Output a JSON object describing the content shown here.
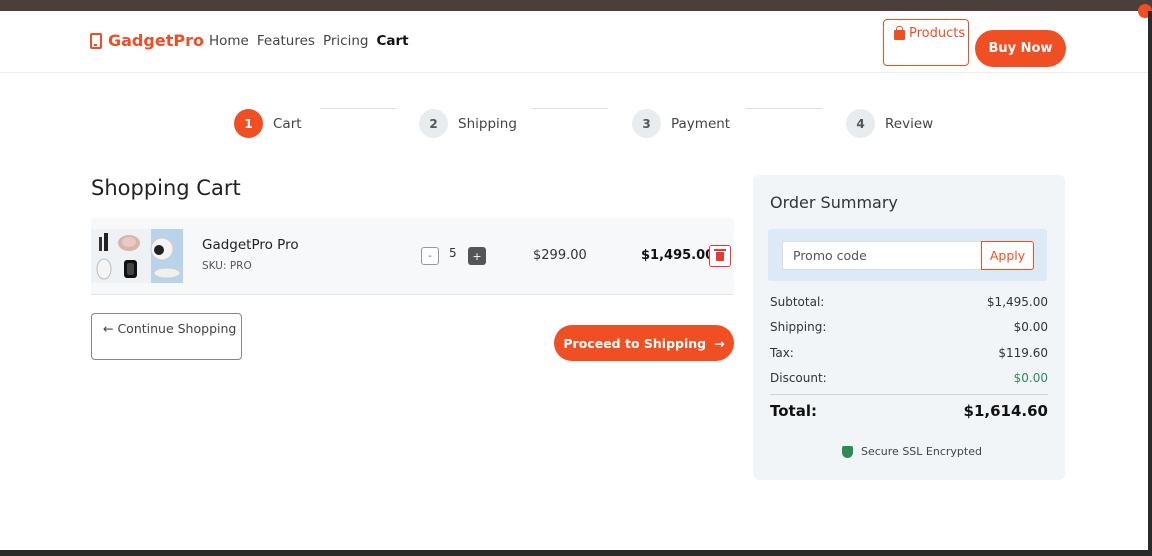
{
  "brand": {
    "name": "GadgetPro"
  },
  "nav": {
    "links": [
      "Home",
      "Features",
      "Pricing",
      "Cart"
    ]
  },
  "header": {
    "products_label": "Products",
    "buy_label": "Buy Now"
  },
  "steps": [
    {
      "num": "1",
      "label": "Cart"
    },
    {
      "num": "2",
      "label": "Shipping"
    },
    {
      "num": "3",
      "label": "Payment"
    },
    {
      "num": "4",
      "label": "Review"
    }
  ],
  "cart": {
    "title": "Shopping Cart",
    "item": {
      "name": "GadgetPro Pro",
      "sku": "SKU: PRO",
      "qty_minus": "-",
      "qty": "5",
      "qty_plus": "+",
      "unit_price": "$299.00",
      "line_total": "$1,495.00"
    },
    "continue_label": "← Continue Shopping",
    "proceed_label": "Proceed to Shipping",
    "proceed_arrow": "→"
  },
  "summary": {
    "title": "Order Summary",
    "promo_placeholder": "Promo code",
    "apply_label": "Apply",
    "subtotal_label": "Subtotal:",
    "subtotal": "$1,495.00",
    "shipping_label": "Shipping:",
    "shipping": "$0.00",
    "tax_label": "Tax:",
    "tax": "$119.60",
    "discount_label": "Discount:",
    "discount": "$0.00",
    "total_label": "Total:",
    "total": "$1,614.60",
    "ssl_label": "Secure SSL Encrypted"
  },
  "colors": {
    "accent": "#f04e23",
    "green": "#2e8b57",
    "summary_bg": "#f1f5f8"
  }
}
